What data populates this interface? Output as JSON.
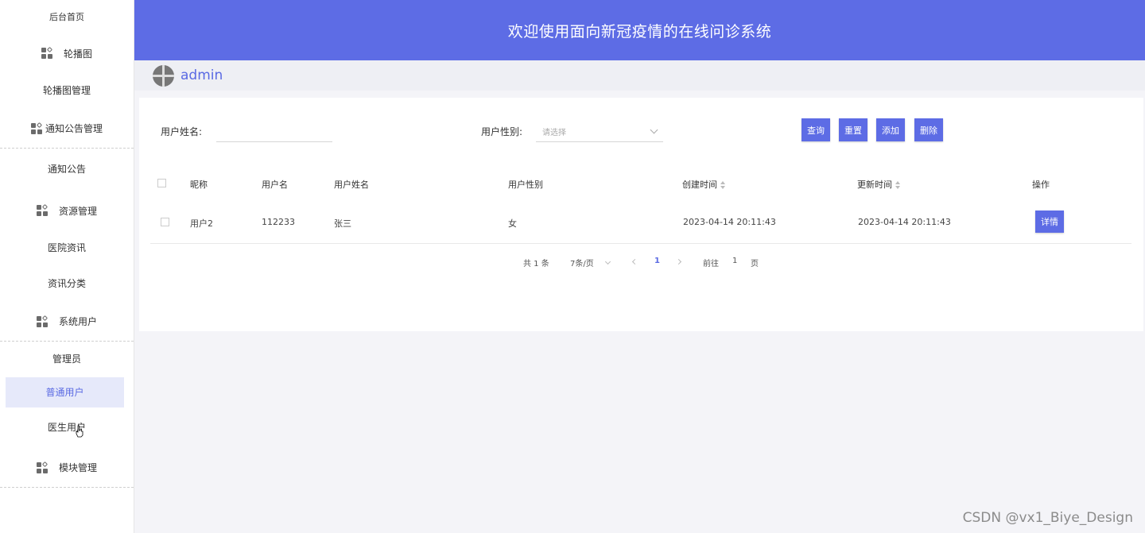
{
  "sidebar": {
    "home": "后台首页",
    "groups": {
      "carousel": {
        "label": "轮播图",
        "items": [
          "轮播图管理"
        ]
      },
      "notice": {
        "label": "通知公告管理",
        "items": [
          "通知公告"
        ]
      },
      "resource": {
        "label": "资源管理",
        "items": [
          "医院资讯",
          "资讯分类"
        ]
      },
      "users": {
        "label": "系统用户",
        "items": [
          "管理员",
          "普通用户",
          "医生用户"
        ]
      },
      "module": {
        "label": "模块管理",
        "items": []
      }
    },
    "active_item": "普通用户"
  },
  "header": {
    "title": "欢迎使用面向新冠疫情的在线问诊系统"
  },
  "adminbar": {
    "username": "admin"
  },
  "search": {
    "name_label": "用户姓名:",
    "name_value": "",
    "gender_label": "用户性别:",
    "gender_placeholder": "请选择"
  },
  "toolbar": {
    "query_label": "查询",
    "reset_label": "重置",
    "add_label": "添加",
    "delete_label": "删除"
  },
  "table": {
    "columns": [
      "昵称",
      "用户名",
      "用户姓名",
      "用户性别",
      "创建时间",
      "更新时间",
      "操作"
    ],
    "rows": [
      {
        "nickname": "用户2",
        "username": "112233",
        "realname": "张三",
        "gender": "女",
        "created": "2023-04-14 20:11:43",
        "updated": "2023-04-14 20:11:43",
        "action": "详情"
      }
    ]
  },
  "pagination": {
    "total": "共 1 条",
    "page_size": "7条/页",
    "current_page": "1",
    "goto_label": "前往",
    "goto_value": "1",
    "page_suffix": "页"
  },
  "watermark": "CSDN @vx1_Biye_Design",
  "colors": {
    "primary": "#5d6ce5",
    "active_bg": "#e6e9fa"
  }
}
